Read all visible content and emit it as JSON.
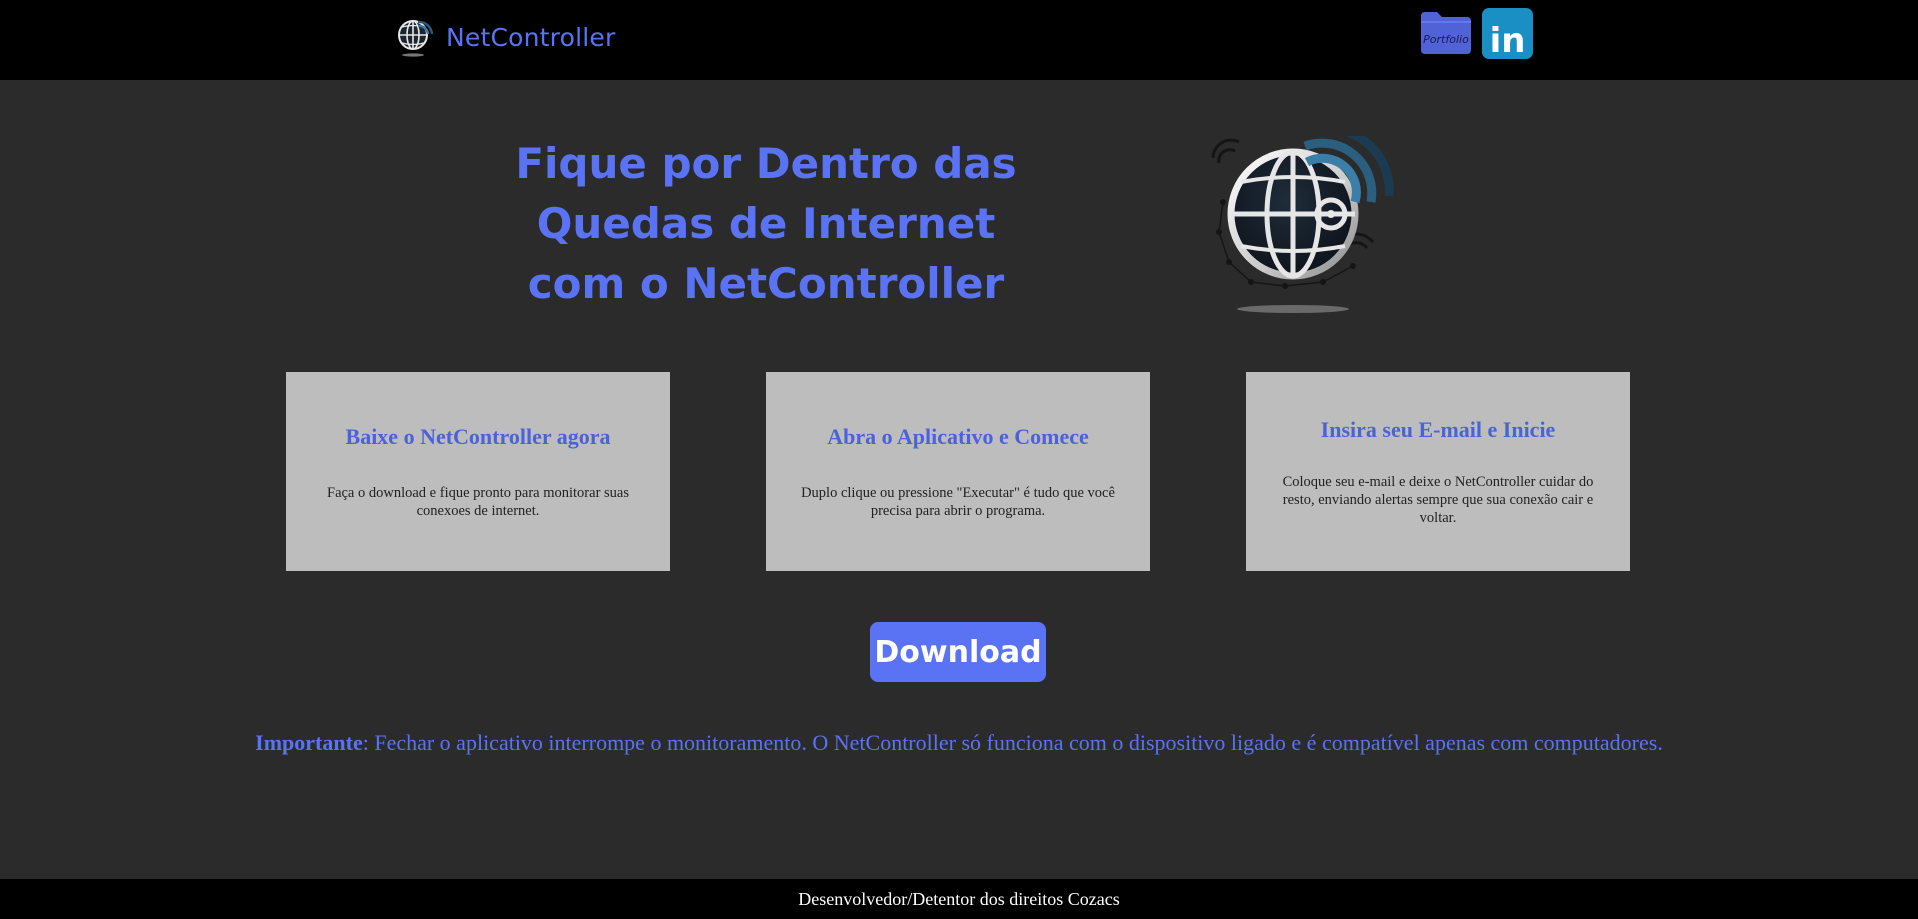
{
  "header": {
    "brand_name": "NetController",
    "portfolio_icon_text": "Portfolio",
    "linkedin_icon_text": "in"
  },
  "hero": {
    "title": "Fique por Dentro das Quedas de Internet com o NetController"
  },
  "cards": [
    {
      "title": "Baixe o NetController agora",
      "text": "Faça o download e fique pronto para monitorar suas conexoes de internet."
    },
    {
      "title": "Abra o Aplicativo e Comece",
      "text": "Duplo clique ou pressione \"Executar\" é tudo que você precisa para abrir o programa."
    },
    {
      "title": "Insira seu E-mail e Inicie",
      "text": "Coloque seu e-mail e deixe o NetController cuidar do resto, enviando alertas sempre que sua conexão cair e voltar."
    }
  ],
  "download_button": {
    "label": "Download"
  },
  "notice": {
    "label": "Importante",
    "text": ": Fechar o aplicativo interrompe o monitoramento. O NetController só funciona com o dispositivo ligado e é compatível apenas com computadores."
  },
  "footer": {
    "text": "Desenvolvedor/Detentor dos direitos Cozacs"
  },
  "colors": {
    "accent": "#5a73f5",
    "card_title": "#4a63d8",
    "card_bg": "#bdbdbd",
    "page_bg": "#2b2b2b",
    "bar_bg": "#000000",
    "linkedin": "#1a8fc4"
  },
  "icons": {
    "brand": "globe-wifi-icon",
    "portfolio": "folder-icon",
    "linkedin": "linkedin-icon",
    "hero": "globe-wifi-icon"
  }
}
